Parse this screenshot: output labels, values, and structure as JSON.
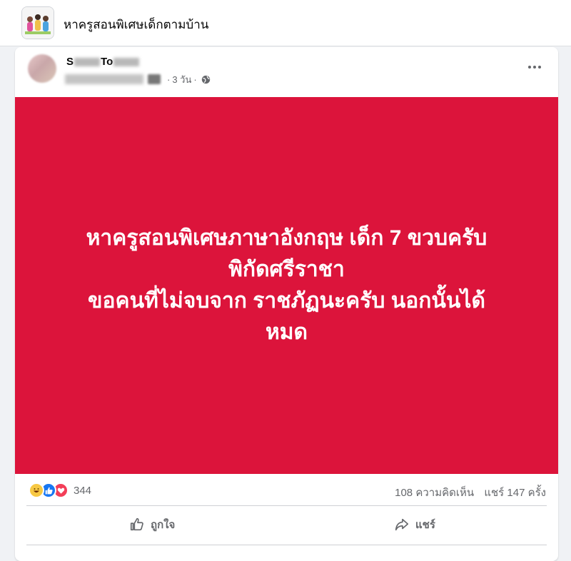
{
  "group": {
    "title": "หาครูสอนพิเศษเด็กตามบ้าน"
  },
  "post": {
    "author_visible": "S",
    "author_visible_2": "To",
    "time": "3 วัน",
    "text": "หาครูสอนพิเศษภาษาอังกฤษ เด็ก 7 ขวบครับ\nพิกัดศรีราชา\nขอคนที่ไม่จบจาก ราชภัฏนะครับ นอกนั้นได้\nหมด",
    "background_color": "#dc143b"
  },
  "engagement": {
    "reaction_count": "344",
    "comments": "108 ความคิดเห็น",
    "shares": "แชร์ 147 ครั้ง",
    "reaction_icons": [
      "haha-icon",
      "like-icon",
      "love-icon"
    ]
  },
  "actions": {
    "like_label": "ถูกใจ",
    "share_label": "แชร์"
  }
}
